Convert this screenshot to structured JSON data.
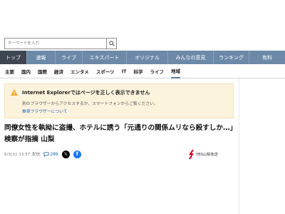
{
  "search": {
    "placeholder": "キーワードを入力"
  },
  "nav": {
    "tabs": [
      {
        "label": "トップ",
        "active": true
      },
      {
        "label": "速報",
        "active": false
      },
      {
        "label": "ライブ",
        "active": false
      },
      {
        "label": "エキスパート",
        "active": false
      },
      {
        "label": "オリジナル",
        "active": false
      },
      {
        "label": "みんなの意見",
        "active": false
      },
      {
        "label": "ランキング",
        "active": false
      },
      {
        "label": "有料",
        "active": false
      }
    ]
  },
  "sub_nav": {
    "tabs": [
      {
        "label": "主要",
        "active": false
      },
      {
        "label": "国内",
        "active": false
      },
      {
        "label": "国際",
        "active": false
      },
      {
        "label": "経済",
        "active": false
      },
      {
        "label": "エンタメ",
        "active": false
      },
      {
        "label": "スポーツ",
        "active": false
      },
      {
        "label": "IT",
        "active": false
      },
      {
        "label": "科学",
        "active": false
      },
      {
        "label": "ライフ",
        "active": false
      },
      {
        "label": "地域",
        "active": true
      }
    ]
  },
  "notice": {
    "title": "Internet Explorerではページを正しく表示できません",
    "text": "別のブラウザーからアクセスするか、スマートフォンからご覧ください。",
    "link": "推奨ブラウザーについて",
    "icon": "warning-icon",
    "accent": "#f5a623"
  },
  "article": {
    "headline": "同僚女性を執拗に盗撮、ホテルに誘う「元通りの関係ムリなら殺すしか…」検察が指摘 山梨",
    "date": "6/3(火) 13:57",
    "status": "配信",
    "comment_count": "289",
    "publisher": "YBS山梨放送"
  }
}
